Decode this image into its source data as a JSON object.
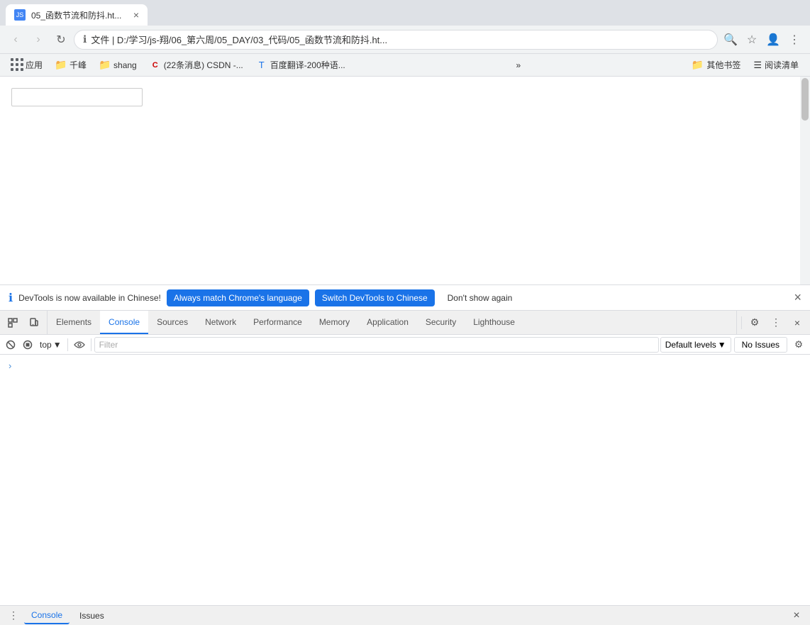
{
  "browser": {
    "tab": {
      "favicon_label": "JS",
      "title": "05_函数节流和防抖.ht..."
    },
    "nav": {
      "back_btn": "‹",
      "forward_btn": "›",
      "reload_btn": "↻",
      "address": "文件 | D:/学习/js-翔/06_第六周/05_DAY/03_代码/05_函数节流和防抖.ht...",
      "search_icon": "🔍",
      "star_icon": "☆",
      "profile_icon": "👤",
      "more_icon": "⋮"
    },
    "bookmarks": [
      {
        "id": "apps",
        "label": "应用",
        "type": "apps"
      },
      {
        "id": "qianfeng",
        "label": "千峰",
        "type": "folder"
      },
      {
        "id": "shang",
        "label": "shang",
        "type": "folder"
      },
      {
        "id": "csdn",
        "label": "(22条消息) CSDN -...",
        "type": "site"
      },
      {
        "id": "translate",
        "label": "百度翻译-200种语...",
        "type": "site"
      }
    ],
    "bookmarks_more": "»",
    "bookmarks_right": [
      {
        "id": "other",
        "label": "其他书签"
      },
      {
        "id": "reading",
        "label": "阅读清单"
      }
    ]
  },
  "page": {
    "input_placeholder": ""
  },
  "devtools": {
    "notification": {
      "icon": "ℹ",
      "message": "DevTools is now available in Chinese!",
      "btn_match": "Always match Chrome's language",
      "btn_switch": "Switch DevTools to Chinese",
      "btn_dismiss": "Don't show again",
      "close": "×"
    },
    "toolbar": {
      "icon_select": "⊡",
      "icon_device": "⬜",
      "tabs": [
        {
          "id": "elements",
          "label": "Elements",
          "active": false
        },
        {
          "id": "console",
          "label": "Console",
          "active": true
        },
        {
          "id": "sources",
          "label": "Sources",
          "active": false
        },
        {
          "id": "network",
          "label": "Network",
          "active": false
        },
        {
          "id": "performance",
          "label": "Performance",
          "active": false
        },
        {
          "id": "memory",
          "label": "Memory",
          "active": false
        },
        {
          "id": "application",
          "label": "Application",
          "active": false
        },
        {
          "id": "security",
          "label": "Security",
          "active": false
        },
        {
          "id": "lighthouse",
          "label": "Lighthouse",
          "active": false
        }
      ],
      "settings_icon": "⚙",
      "more_icon": "⋮",
      "close_icon": "×"
    },
    "console_toolbar": {
      "clear_icon": "🚫",
      "stop_icon": "⊘",
      "context_top": "top",
      "context_arrow": "▼",
      "eye_icon": "👁",
      "filter_placeholder": "Filter",
      "default_levels": "Default levels",
      "default_levels_arrow": "▼",
      "no_issues": "No Issues",
      "settings_icon": "⚙"
    },
    "console_content": {
      "arrow": "›"
    },
    "bottom": {
      "menu_icon": "⋮",
      "tabs": [
        {
          "id": "console",
          "label": "Console",
          "active": true
        },
        {
          "id": "issues",
          "label": "Issues",
          "active": false
        }
      ],
      "close_icon": "×"
    }
  }
}
